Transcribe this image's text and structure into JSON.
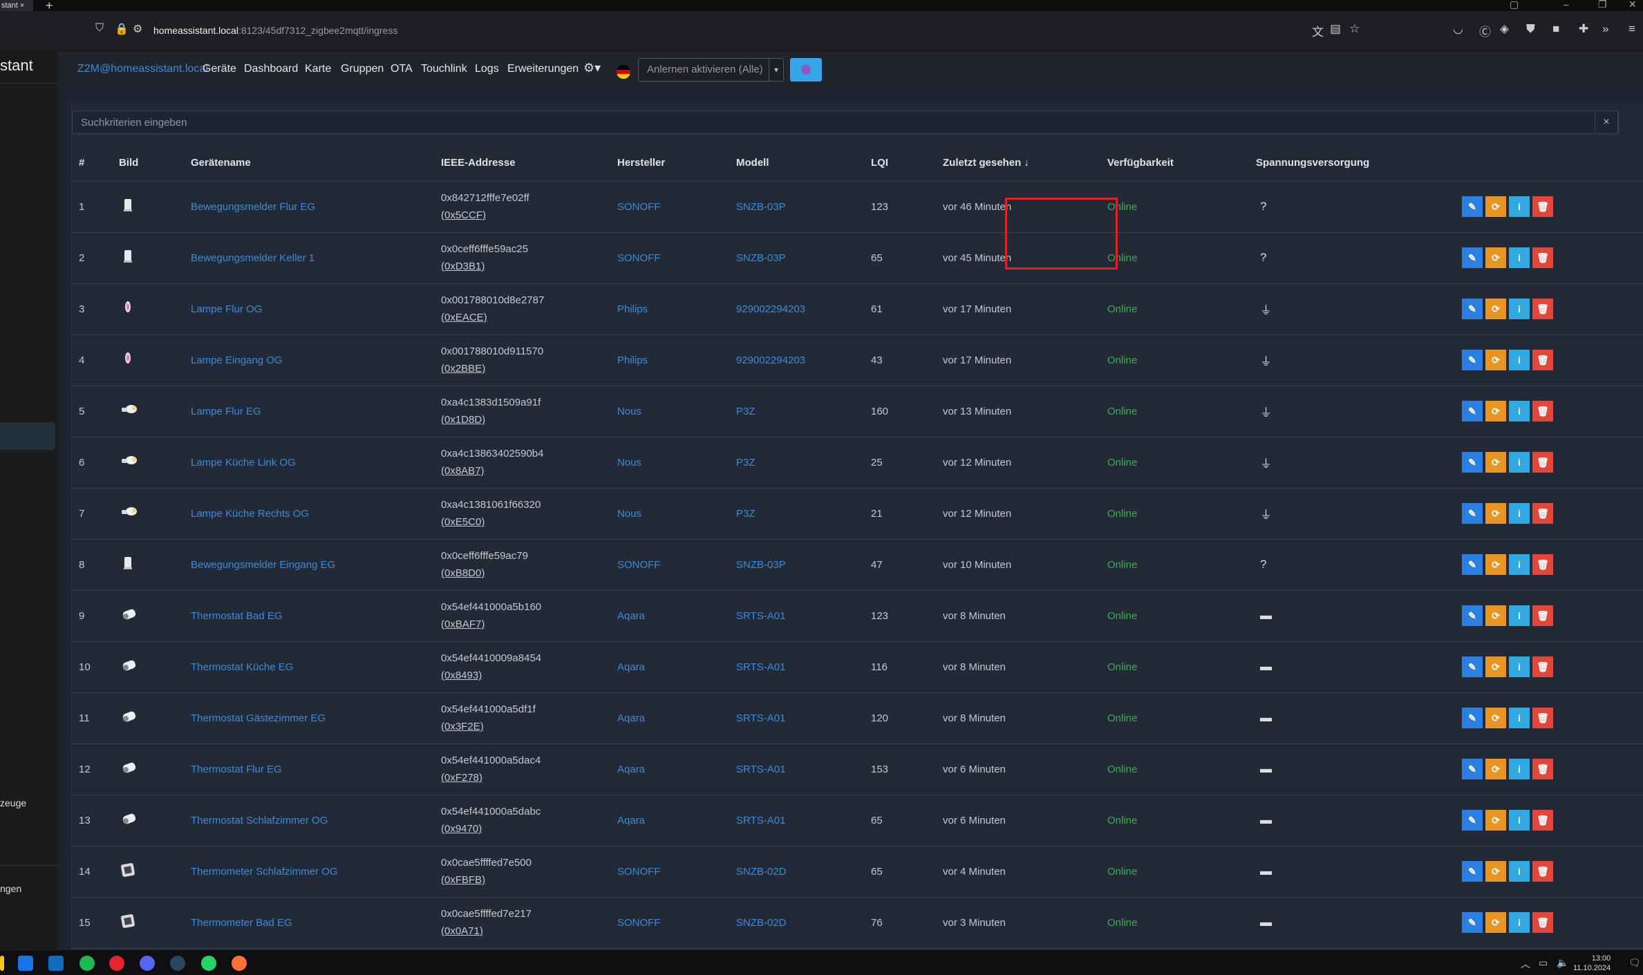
{
  "browser": {
    "tab_title": "stant",
    "url_host": "homeassistant.local",
    "url_path": ":8123/45df7312_zigbee2mqtt/ingress"
  },
  "ha_sidebar": {
    "title": "stant",
    "item_tools": "zeuge",
    "item_settings": "ngen"
  },
  "nav": {
    "brand": "Z2M@homeassistant.local",
    "links": [
      "Geräte",
      "Dashboard",
      "Karte",
      "Gruppen",
      "OTA",
      "Touchlink",
      "Logs",
      "Erweiterungen"
    ],
    "permit_join": "Anlernen aktivieren (Alle)"
  },
  "search": {
    "placeholder": "Suchkriterien eingeben",
    "clear": "×"
  },
  "table": {
    "headers": [
      "#",
      "Bild",
      "Gerätename",
      "IEEE-Addresse",
      "Hersteller",
      "Modell",
      "LQI",
      "Zuletzt gesehen ↓",
      "Verfügbarkeit",
      "Spannungsversorgung"
    ],
    "rows": [
      {
        "n": "1",
        "name": "Bewegungsmelder Flur EG",
        "ieee": "0x842712fffe7e02ff",
        "nwk": "(0x5CCF)",
        "vendor": "SONOFF",
        "model": "SNZB-03P",
        "lqi": "123",
        "seen": "vor 46 Minuten",
        "avail": "Online",
        "power": "?",
        "icon": "motion-sensor"
      },
      {
        "n": "2",
        "name": "Bewegungsmelder Keller 1",
        "ieee": "0x0ceff6fffe59ac25",
        "nwk": "(0xD3B1)",
        "vendor": "SONOFF",
        "model": "SNZB-03P",
        "lqi": "65",
        "seen": "vor 45 Minuten",
        "avail": "Online",
        "power": "?",
        "icon": "motion-sensor"
      },
      {
        "n": "3",
        "name": "Lampe Flur OG",
        "ieee": "0x001788010d8e2787",
        "nwk": "(0xEACE)",
        "vendor": "Philips",
        "model": "929002294203",
        "lqi": "61",
        "seen": "vor 17 Minuten",
        "avail": "Online",
        "power": "⏚",
        "icon": "candle-bulb"
      },
      {
        "n": "4",
        "name": "Lampe Eingang OG",
        "ieee": "0x001788010d911570",
        "nwk": "(0x2BBE)",
        "vendor": "Philips",
        "model": "929002294203",
        "lqi": "43",
        "seen": "vor 17 Minuten",
        "avail": "Online",
        "power": "⏚",
        "icon": "candle-bulb"
      },
      {
        "n": "5",
        "name": "Lampe Flur EG",
        "ieee": "0xa4c1383d1509a91f",
        "nwk": "(0x1D8D)",
        "vendor": "Nous",
        "model": "P3Z",
        "lqi": "160",
        "seen": "vor 13 Minuten",
        "avail": "Online",
        "power": "⏚",
        "icon": "bulb"
      },
      {
        "n": "6",
        "name": "Lampe Küche Link OG",
        "ieee": "0xa4c13863402590b4",
        "nwk": "(0x8AB7)",
        "vendor": "Nous",
        "model": "P3Z",
        "lqi": "25",
        "seen": "vor 12 Minuten",
        "avail": "Online",
        "power": "⏚",
        "icon": "bulb"
      },
      {
        "n": "7",
        "name": "Lampe Küche Rechts OG",
        "ieee": "0xa4c1381061f66320",
        "nwk": "(0xE5C0)",
        "vendor": "Nous",
        "model": "P3Z",
        "lqi": "21",
        "seen": "vor 12 Minuten",
        "avail": "Online",
        "power": "⏚",
        "icon": "bulb"
      },
      {
        "n": "8",
        "name": "Bewegungsmelder Eingang EG",
        "ieee": "0x0ceff6fffe59ac79",
        "nwk": "(0xB8D0)",
        "vendor": "SONOFF",
        "model": "SNZB-03P",
        "lqi": "47",
        "seen": "vor 10 Minuten",
        "avail": "Online",
        "power": "?",
        "icon": "motion-sensor"
      },
      {
        "n": "9",
        "name": "Thermostat Bad EG",
        "ieee": "0x54ef441000a5b160",
        "nwk": "(0xBAF7)",
        "vendor": "Aqara",
        "model": "SRTS-A01",
        "lqi": "123",
        "seen": "vor 8 Minuten",
        "avail": "Online",
        "power": "▬",
        "icon": "thermostat"
      },
      {
        "n": "10",
        "name": "Thermostat Küche EG",
        "ieee": "0x54ef4410009a8454",
        "nwk": "(0x8493)",
        "vendor": "Aqara",
        "model": "SRTS-A01",
        "lqi": "116",
        "seen": "vor 8 Minuten",
        "avail": "Online",
        "power": "▬",
        "icon": "thermostat"
      },
      {
        "n": "11",
        "name": "Thermostat Gästezimmer EG",
        "ieee": "0x54ef441000a5df1f",
        "nwk": "(0x3F2E)",
        "vendor": "Aqara",
        "model": "SRTS-A01",
        "lqi": "120",
        "seen": "vor 8 Minuten",
        "avail": "Online",
        "power": "▬",
        "icon": "thermostat"
      },
      {
        "n": "12",
        "name": "Thermostat Flur EG",
        "ieee": "0x54ef441000a5dac4",
        "nwk": "(0xF278)",
        "vendor": "Aqara",
        "model": "SRTS-A01",
        "lqi": "153",
        "seen": "vor 6 Minuten",
        "avail": "Online",
        "power": "▬",
        "icon": "thermostat"
      },
      {
        "n": "13",
        "name": "Thermostat Schlafzimmer OG",
        "ieee": "0x54ef441000a5dabc",
        "nwk": "(0x9470)",
        "vendor": "Aqara",
        "model": "SRTS-A01",
        "lqi": "65",
        "seen": "vor 6 Minuten",
        "avail": "Online",
        "power": "▬",
        "icon": "thermostat"
      },
      {
        "n": "14",
        "name": "Thermometer Schlafzimmer OG",
        "ieee": "0x0cae5ffffed7e500",
        "nwk": "(0xFBFB)",
        "vendor": "SONOFF",
        "model": "SNZB-02D",
        "lqi": "65",
        "seen": "vor 4 Minuten",
        "avail": "Online",
        "power": "▬",
        "icon": "thermometer"
      },
      {
        "n": "15",
        "name": "Thermometer Bad EG",
        "ieee": "0x0cae5ffffed7e217",
        "nwk": "(0x0A71)",
        "vendor": "SONOFF",
        "model": "SNZB-02D",
        "lqi": "76",
        "seen": "vor 3 Minuten",
        "avail": "Online",
        "power": "▬",
        "icon": "thermometer"
      }
    ]
  },
  "actions": {
    "edit": "✎",
    "reconfigure": "⟳",
    "info": "i",
    "delete": "🗑"
  },
  "taskbar": {
    "time": "13:00",
    "date": "11.10.2024"
  }
}
